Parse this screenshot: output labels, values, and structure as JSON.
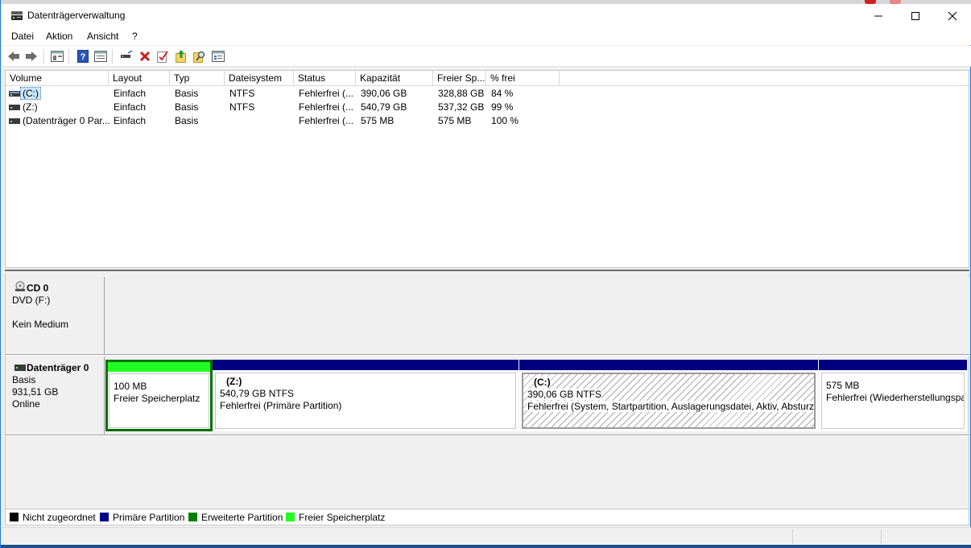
{
  "window": {
    "title": "Datenträgerverwaltung"
  },
  "menu": [
    "Datei",
    "Aktion",
    "Ansicht",
    "?"
  ],
  "toolbar_icons": [
    "back-icon",
    "forward-icon",
    "console-tree-icon",
    "help-icon",
    "properties-icon",
    "connect-icon",
    "delete-icon",
    "check-icon",
    "export-icon",
    "search-icon",
    "list-view-icon"
  ],
  "volume_table": {
    "headers": [
      "Volume",
      "Layout",
      "Typ",
      "Dateisystem",
      "Status",
      "Kapazität",
      "Freier Sp...",
      "% frei"
    ],
    "rows": [
      [
        "(C:)",
        "Einfach",
        "Basis",
        "NTFS",
        "Fehlerfrei (...",
        "390,06 GB",
        "328,88 GB",
        "84 %"
      ],
      [
        "(Z:)",
        "Einfach",
        "Basis",
        "NTFS",
        "Fehlerfrei (...",
        "540,79 GB",
        "537,32 GB",
        "99 %"
      ],
      [
        "(Datenträger 0 Par...",
        "Einfach",
        "Basis",
        "",
        "Fehlerfrei (...",
        "575 MB",
        "575 MB",
        "100 %"
      ]
    ]
  },
  "cd": {
    "name": "CD 0",
    "drive": "DVD (F:)",
    "medium": "Kein Medium"
  },
  "disk0": {
    "name": "Datenträger 0",
    "type": "Basis",
    "size": "931,51 GB",
    "state": "Online",
    "partitions": [
      {
        "title": "",
        "line1": "100 MB",
        "line2": "Freier Speicherplatz"
      },
      {
        "title": "(Z:)",
        "line1": "540,79 GB NTFS",
        "line2": "Fehlerfrei (Primäre Partition)"
      },
      {
        "title": "(C:)",
        "line1": "390,06 GB NTFS",
        "line2": "Fehlerfrei (System, Startpartition, Auslagerungsdatei, Aktiv, Absturzabbild, Primäre Partition)"
      },
      {
        "title": "",
        "line1": "575 MB",
        "line2": "Fehlerfrei (Wiederherstellungspartition)"
      }
    ]
  },
  "legend": [
    {
      "label": "Nicht zugeordnet",
      "color": "#000000"
    },
    {
      "label": "Primäre Partition",
      "color": "#00008b"
    },
    {
      "label": "Erweiterte Partition",
      "color": "#008000"
    },
    {
      "label": "Freier Speicherplatz",
      "color": "#22ff22"
    }
  ],
  "colors": {
    "primary": "#000080",
    "free": "#22ff22",
    "free_border": "#007000",
    "accent": "#1e78d6"
  }
}
